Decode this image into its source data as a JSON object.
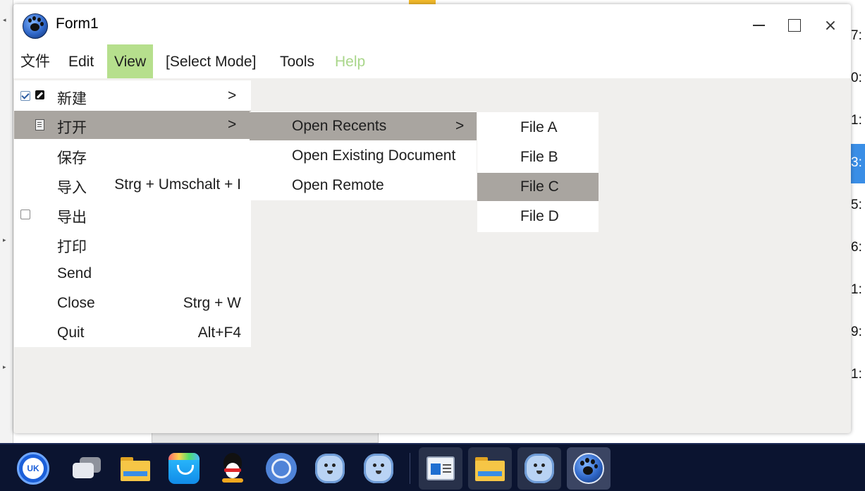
{
  "background": {
    "right_column_times": [
      "7:",
      "0:",
      "1:",
      "3:",
      "5:",
      "6:",
      "1:",
      "9:",
      "1:"
    ]
  },
  "window": {
    "title": "Form1",
    "controls": {
      "minimize": "minimize",
      "maximize": "maximize",
      "close": "×"
    }
  },
  "menubar": {
    "items": [
      {
        "label": "文件",
        "state": "normal"
      },
      {
        "label": "Edit",
        "state": "normal"
      },
      {
        "label": "View",
        "state": "active"
      },
      {
        "label": "[Select Mode]",
        "state": "normal"
      },
      {
        "label": "Tools",
        "state": "normal"
      },
      {
        "label": "Help",
        "state": "disabled"
      }
    ]
  },
  "file_menu": {
    "items": [
      {
        "label": "新建",
        "shortcut": "",
        "arrow": ">",
        "checkbox": "checked",
        "icon": "edit-icon"
      },
      {
        "label": "打开",
        "shortcut": "",
        "arrow": ">",
        "checkbox": "",
        "icon": "open-file-icon",
        "highlight": true
      },
      {
        "label": "保存",
        "shortcut": "",
        "arrow": "",
        "checkbox": ""
      },
      {
        "label": "导入",
        "shortcut": "Strg + Umschalt + I",
        "arrow": "",
        "checkbox": ""
      },
      {
        "label": "导出",
        "shortcut": "",
        "arrow": "",
        "checkbox": "unchecked"
      },
      {
        "label": "打印",
        "shortcut": "",
        "arrow": "",
        "checkbox": ""
      },
      {
        "label": "Send",
        "shortcut": "",
        "arrow": "",
        "checkbox": ""
      },
      {
        "label": "Close",
        "shortcut": "Strg + W",
        "arrow": "",
        "checkbox": ""
      },
      {
        "label": "Quit",
        "shortcut": "Alt+F4",
        "arrow": "",
        "checkbox": ""
      }
    ]
  },
  "open_submenu": {
    "items": [
      {
        "label": "Open Recents",
        "arrow": ">",
        "highlight": true
      },
      {
        "label": "Open Existing Document",
        "arrow": ""
      },
      {
        "label": "Open Remote",
        "arrow": ""
      }
    ]
  },
  "recents_submenu": {
    "items": [
      {
        "label": "File A",
        "highlight": false
      },
      {
        "label": "File B",
        "highlight": false
      },
      {
        "label": "File C",
        "highlight": true
      },
      {
        "label": "File D",
        "highlight": false
      }
    ]
  },
  "taskbar": {
    "apps": [
      {
        "name": "uk-launcher-icon",
        "text": "UK",
        "state": "pinned"
      },
      {
        "name": "multitask-view-icon",
        "state": "pinned"
      },
      {
        "name": "file-manager-icon",
        "state": "pinned"
      },
      {
        "name": "app-store-icon",
        "state": "pinned"
      },
      {
        "name": "qq-icon",
        "state": "pinned"
      },
      {
        "name": "chromium-browser-icon",
        "state": "pinned"
      },
      {
        "name": "cheetah-app-icon",
        "state": "pinned"
      },
      {
        "name": "cheetah-app-icon",
        "state": "pinned"
      },
      {
        "name": "text-editor-icon",
        "state": "running"
      },
      {
        "name": "file-manager-icon",
        "state": "running"
      },
      {
        "name": "cheetah-app-icon",
        "state": "running"
      },
      {
        "name": "paw-app-icon",
        "state": "active"
      }
    ]
  },
  "colors": {
    "menu_active_bg": "#b6df8d",
    "menu_disabled_fg": "#a9d68a",
    "dropdown_highlight_bg": "#a9a5a0",
    "window_bg": "#f0efed",
    "taskbar_bg": "#0b1430",
    "selection_blue": "#3a8ee6"
  }
}
